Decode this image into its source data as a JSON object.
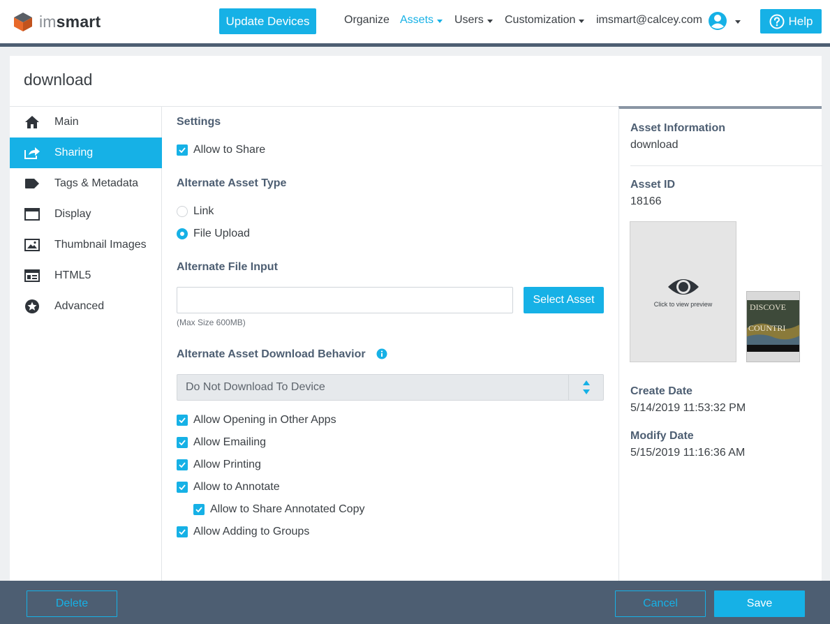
{
  "header": {
    "logo_thin": "im",
    "logo_bold": "smart",
    "update_label": "Update Devices",
    "nav": {
      "organize": "Organize",
      "assets": "Assets",
      "users": "Users",
      "customization": "Customization",
      "account": "imsmart@calcey.com"
    },
    "help_label": "Help",
    "brand_color": "#16b1e6"
  },
  "page": {
    "title": "download"
  },
  "sidebar": {
    "items": [
      {
        "label": "Main",
        "icon": "home-icon"
      },
      {
        "label": "Sharing",
        "icon": "share-icon",
        "active": true
      },
      {
        "label": "Tags & Metadata",
        "icon": "tag-icon"
      },
      {
        "label": "Display",
        "icon": "window-icon"
      },
      {
        "label": "Thumbnail Images",
        "icon": "image-icon"
      },
      {
        "label": "HTML5",
        "icon": "html5-icon"
      },
      {
        "label": "Advanced",
        "icon": "star-icon"
      }
    ]
  },
  "settings": {
    "title": "Settings",
    "allow_share": "Allow to Share",
    "alt_type_title": "Alternate Asset Type",
    "radio_link": "Link",
    "radio_file": "File Upload",
    "alt_file_title": "Alternate File Input",
    "file_value": "",
    "select_asset": "Select Asset",
    "max_size": "(Max Size 600MB)",
    "download_title": "Alternate Asset Download Behavior",
    "download_value": "Do Not Download To Device",
    "opt_open": "Allow Opening in Other Apps",
    "opt_email": "Allow Emailing",
    "opt_print": "Allow Printing",
    "opt_annotate": "Allow to Annotate",
    "opt_share_annotated": "Allow to Share Annotated Copy",
    "opt_groups": "Allow Adding to Groups"
  },
  "info": {
    "title": "Asset Information",
    "name": "download",
    "id_label": "Asset ID",
    "id_value": "18166",
    "preview_text": "Click to view preview",
    "thumb_line1": "DISCOVE",
    "thumb_line2": "COUNTRI",
    "create_label": "Create Date",
    "create_value": "5/14/2019 11:53:32 PM",
    "modify_label": "Modify Date",
    "modify_value": "5/15/2019 11:16:36 AM"
  },
  "footer": {
    "delete": "Delete",
    "cancel": "Cancel",
    "save": "Save"
  }
}
